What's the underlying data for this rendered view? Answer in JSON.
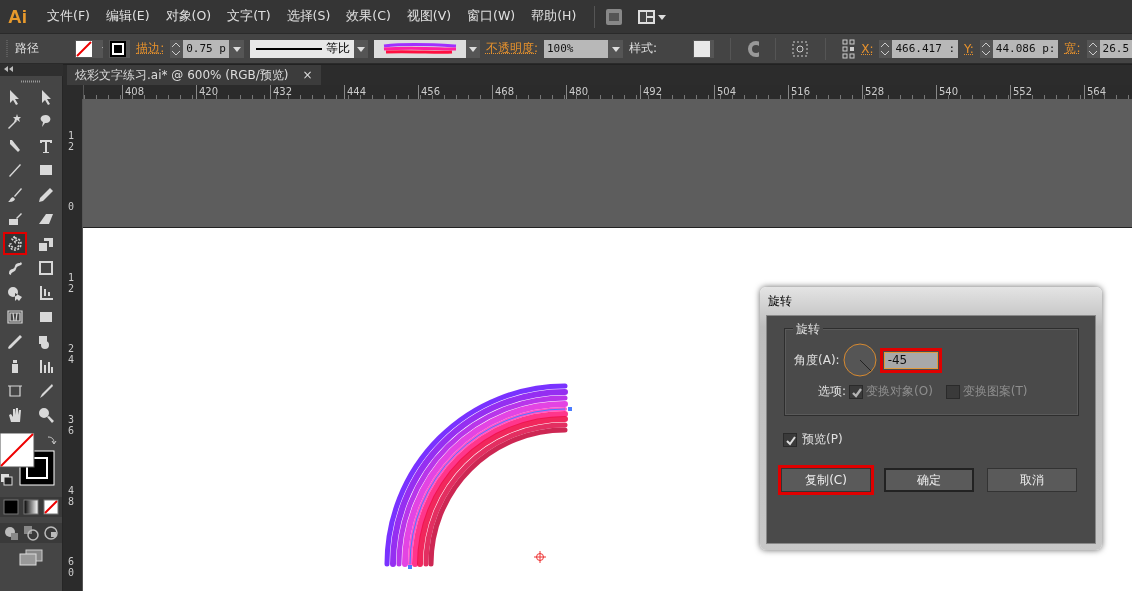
{
  "app": {
    "logo": "Ai"
  },
  "menu": [
    "文件(F)",
    "编辑(E)",
    "对象(O)",
    "文字(T)",
    "选择(S)",
    "效果(C)",
    "视图(V)",
    "窗口(W)",
    "帮助(H)"
  ],
  "control_bar": {
    "selection": "路径",
    "stroke_label": "描边:",
    "stroke_weight": "0.75 p",
    "profile": "等比",
    "opacity_label": "不透明度:",
    "opacity": "100%",
    "style_label": "样式:",
    "x_label": "X:",
    "x": "466.417 :",
    "y_label": "Y:",
    "y": "44.086 p:",
    "w_label": "宽:",
    "w": "26.5"
  },
  "document_tab": {
    "title": "炫彩文字练习.ai* @ 600% (RGB/预览)",
    "close": "×"
  },
  "ruler": {
    "horizontal": [
      "408",
      "420",
      "432",
      "444",
      "456",
      "468",
      "480",
      "492",
      "504",
      "516",
      "528",
      "540",
      "552",
      "564"
    ],
    "vertical": [
      "12",
      "0",
      "12",
      "24",
      "36",
      "48",
      "60"
    ]
  },
  "tools": [
    {
      "highlighted": false
    },
    {
      "highlighted": false
    },
    {
      "highlighted": false
    },
    {
      "highlighted": false
    },
    {
      "highlighted": false
    },
    {
      "highlighted": false
    },
    {
      "highlighted": false
    },
    {
      "highlighted": false
    },
    {
      "highlighted": false
    },
    {
      "highlighted": false
    },
    {
      "highlighted": false
    },
    {
      "highlighted": false
    },
    {
      "highlighted": true
    },
    {
      "highlighted": false
    },
    {
      "highlighted": false
    },
    {
      "highlighted": false
    },
    {
      "highlighted": false
    },
    {
      "highlighted": false
    },
    {
      "highlighted": false
    },
    {
      "highlighted": false
    },
    {
      "highlighted": false
    },
    {
      "highlighted": false
    },
    {
      "highlighted": false
    },
    {
      "highlighted": false
    },
    {
      "highlighted": false
    },
    {
      "highlighted": false
    },
    {
      "highlighted": false
    },
    {
      "highlighted": false
    }
  ],
  "dialog": {
    "title": "旋转",
    "group_label": "旋转",
    "angle_label": "角度(A):",
    "angle": "-45",
    "angle_highlighted": true,
    "options_label": "选项:",
    "options": [
      {
        "label": "变换对象(O)",
        "checked": true,
        "disabled": true
      },
      {
        "label": "变换图案(T)",
        "checked": false,
        "disabled": true
      }
    ],
    "preview": {
      "label": "预览(P)",
      "checked": true
    },
    "buttons": [
      {
        "label": "复制(C)",
        "highlighted": true,
        "default": false
      },
      {
        "label": "确定",
        "highlighted": false,
        "default": true
      },
      {
        "label": "取消",
        "highlighted": false,
        "default": false
      }
    ]
  }
}
